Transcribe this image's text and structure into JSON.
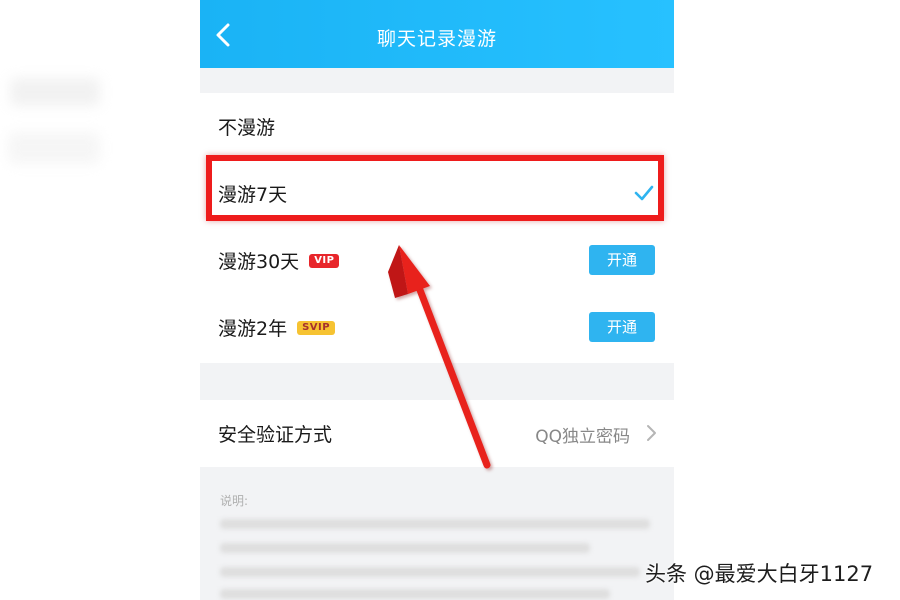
{
  "header": {
    "title": "聊天记录漫游",
    "back_icon": "chevron-left-icon"
  },
  "options": [
    {
      "label": "不漫游"
    },
    {
      "label": "漫游7天",
      "selected": true
    },
    {
      "label": "漫游30天",
      "badge": "VIP",
      "button": "开通"
    },
    {
      "label": "漫游2年",
      "badge": "SVIP",
      "button": "开通"
    }
  ],
  "security": {
    "label": "安全验证方式",
    "value": "QQ独立密码"
  },
  "description": {
    "title": "说明:"
  },
  "watermark": "头条 @最爱大白牙1127",
  "colors": {
    "titlebar": "#1ab3f5",
    "accent": "#2fb4f0",
    "highlight": "#ee1c1c",
    "vip_badge": "#e8262b",
    "svip_badge": "#f6c332"
  }
}
